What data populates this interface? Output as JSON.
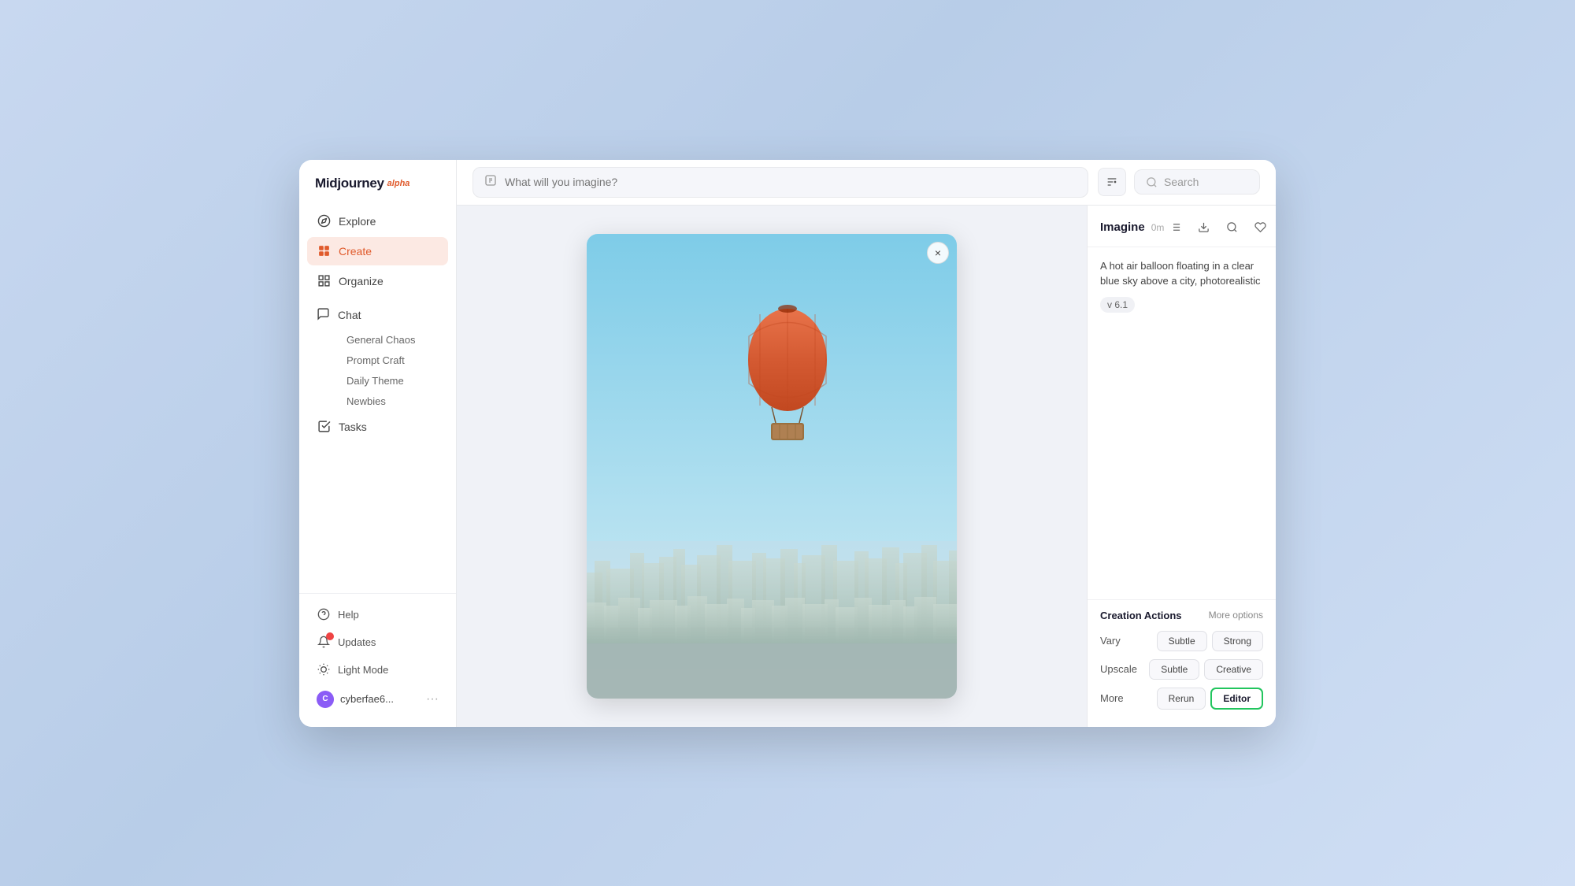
{
  "app": {
    "name": "Midjourney",
    "alpha_label": "alpha"
  },
  "sidebar": {
    "nav_items": [
      {
        "id": "explore",
        "label": "Explore",
        "icon": "🧭"
      },
      {
        "id": "create",
        "label": "Create",
        "icon": "✦",
        "active": true
      },
      {
        "id": "organize",
        "label": "Organize",
        "icon": "⊞"
      }
    ],
    "chat": {
      "label": "Chat",
      "subitems": [
        {
          "id": "general-chaos",
          "label": "General Chaos"
        },
        {
          "id": "prompt-craft",
          "label": "Prompt Craft"
        },
        {
          "id": "daily-theme",
          "label": "Daily Theme"
        },
        {
          "id": "newbies",
          "label": "Newbies"
        }
      ]
    },
    "tasks": {
      "label": "Tasks",
      "icon": "✓"
    },
    "bottom": {
      "help": "Help",
      "updates": "Updates",
      "light_mode": "Light Mode",
      "user_name": "cyberfae6...",
      "user_more": "···"
    }
  },
  "topbar": {
    "prompt_placeholder": "What will you imagine?",
    "search_label": "Search"
  },
  "image_panel": {
    "close_label": "×"
  },
  "details": {
    "title": "Imagine",
    "time": "0m",
    "prompt_text": "A hot air balloon floating in a clear blue sky above a city, photorealistic",
    "version_badge": "v 6.1",
    "icons": [
      "list",
      "download",
      "search",
      "heart"
    ]
  },
  "creation_actions": {
    "title": "Creation Actions",
    "more_options": "More options",
    "vary": {
      "label": "Vary",
      "buttons": [
        "Subtle",
        "Strong"
      ]
    },
    "upscale": {
      "label": "Upscale",
      "buttons": [
        "Subtle",
        "Creative"
      ]
    },
    "more": {
      "label": "More",
      "buttons": [
        "Rerun",
        "Editor"
      ]
    }
  }
}
